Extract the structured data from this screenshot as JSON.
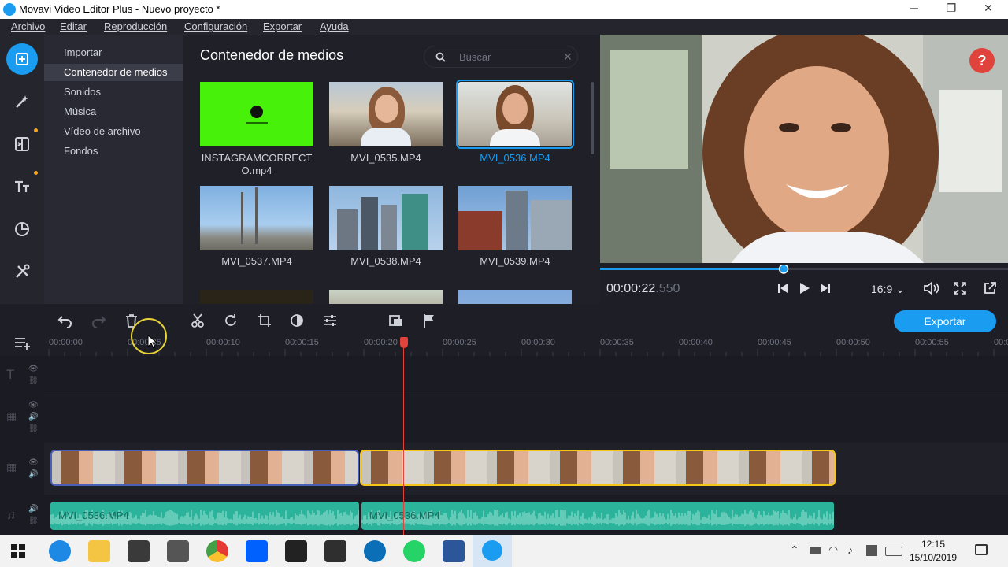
{
  "window": {
    "title": "Movavi Video Editor Plus - Nuevo proyecto *",
    "minimize_glyph": "─",
    "restore_glyph": "❐",
    "close_glyph": "✕"
  },
  "menu": [
    "Archivo",
    "Editar",
    "Reproducción",
    "Configuración",
    "Exportar",
    "Ayuda"
  ],
  "rail": {
    "icons": [
      "import-media-icon",
      "magic-wand-icon",
      "transitions-icon",
      "titles-icon",
      "stickers-icon",
      "tools-icon"
    ]
  },
  "categories": [
    "Importar",
    "Contenedor de medios",
    "Sonidos",
    "Música",
    "Vídeo de archivo",
    "Fondos"
  ],
  "media": {
    "title": "Contenedor de medios",
    "search_placeholder": "Buscar",
    "items": [
      {
        "name": "INSTAGRAMCORRECTO.mp4",
        "name_line1": "INSTAGRAMCORRECT",
        "name_line2": "O.mp4"
      },
      {
        "name": "MVI_0535.MP4"
      },
      {
        "name": "MVI_0536.MP4"
      },
      {
        "name": "MVI_0537.MP4"
      },
      {
        "name": "MVI_0538.MP4"
      },
      {
        "name": "MVI_0539.MP4"
      }
    ]
  },
  "preview": {
    "timecode_main": "00:00:22",
    "timecode_frac": ".550",
    "progress": 0.45,
    "aspect": "16:9",
    "help": "?"
  },
  "timeline": {
    "export_label": "Exportar",
    "ticks": [
      "00:00:00",
      "00:00:05",
      "00:00:10",
      "00:00:15",
      "00:00:20",
      "00:00:25",
      "00:00:30",
      "00:00:35",
      "00:00:40",
      "00:00:45",
      "00:00:50",
      "00:00:55",
      "00:0"
    ],
    "playhead_time": "00:00:22.550",
    "audio_clips": [
      "MVI_0536.MP4",
      "MVI_0536.MP4"
    ]
  },
  "taskbar": {
    "time": "12:15",
    "date": "15/10/2019"
  },
  "colors": {
    "accent": "#1a9cf0",
    "selected_clip": "#f5c518",
    "audio": "#2bb39b",
    "playhead": "#e0433b"
  }
}
